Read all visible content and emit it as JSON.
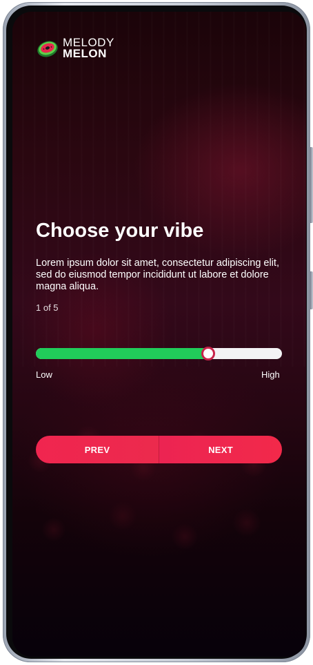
{
  "brand": {
    "line1": "MELODY",
    "line2": "MELON",
    "logo_icon": "watermelon-disc-icon"
  },
  "onboarding": {
    "title": "Choose your vibe",
    "description": "Lorem ipsum dolor sit amet, consectetur adipiscing elit, sed do eiusmod tempor incididunt ut labore et dolore magna aliqua.",
    "step_text": "1 of 5"
  },
  "vibe_slider": {
    "value": 0.7,
    "min_label": "Low",
    "max_label": "High"
  },
  "navigation": {
    "prev_label": "PREV",
    "next_label": "NEXT"
  },
  "colors": {
    "accent": "#f0254f",
    "slider_fill": "#21cc5a",
    "slider_track": "#f3f3f5",
    "thumb_border": "#c8234a",
    "background": "#2a0710"
  }
}
